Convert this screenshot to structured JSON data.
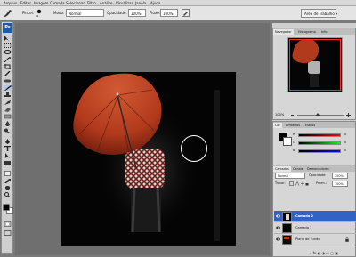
{
  "menu": [
    "Arquivo",
    "Editar",
    "Imagem",
    "Camada",
    "Selecionar",
    "Filtro",
    "Análise",
    "Visualizar",
    "Janela",
    "Ajuda"
  ],
  "options_bar": {
    "brush_label": "Pincel:",
    "brush_size": "60",
    "mode_label": "Modo:",
    "mode_value": "Normal",
    "opacity_label": "Opacidade:",
    "opacity_value": "100%",
    "flow_label": "Fluxo:",
    "flow_value": "100%",
    "workspace_label": "Área de Trabalho ▾"
  },
  "toolbox": {
    "logo": "Ps"
  },
  "navigator": {
    "tabs": [
      "Navegador",
      "Histograma",
      "Info"
    ],
    "zoom": "100%"
  },
  "color_panel": {
    "tabs": [
      "Cor",
      "Amostras",
      "Estilos"
    ],
    "channels": [
      "R",
      "G",
      "B"
    ],
    "values": [
      "0",
      "0",
      "0"
    ]
  },
  "layers_panel": {
    "tabs": [
      "Camadas",
      "Canais",
      "Demarcadores"
    ],
    "blend_mode": "Normal",
    "opacity_label": "Opacidade:",
    "opacity_value": "100%",
    "lock_label": "Travar:",
    "fill_label": "Preen.:",
    "fill_value": "100%",
    "layers": [
      {
        "name": "Camada 2",
        "selected": true
      },
      {
        "name": "Camada 1",
        "selected": false
      },
      {
        "name": "Plano de Fundo",
        "selected": false
      }
    ]
  },
  "colors": {
    "umbrella": "#b23a1c",
    "selection": "#3064c4",
    "view_box": "#ff2a2a"
  }
}
